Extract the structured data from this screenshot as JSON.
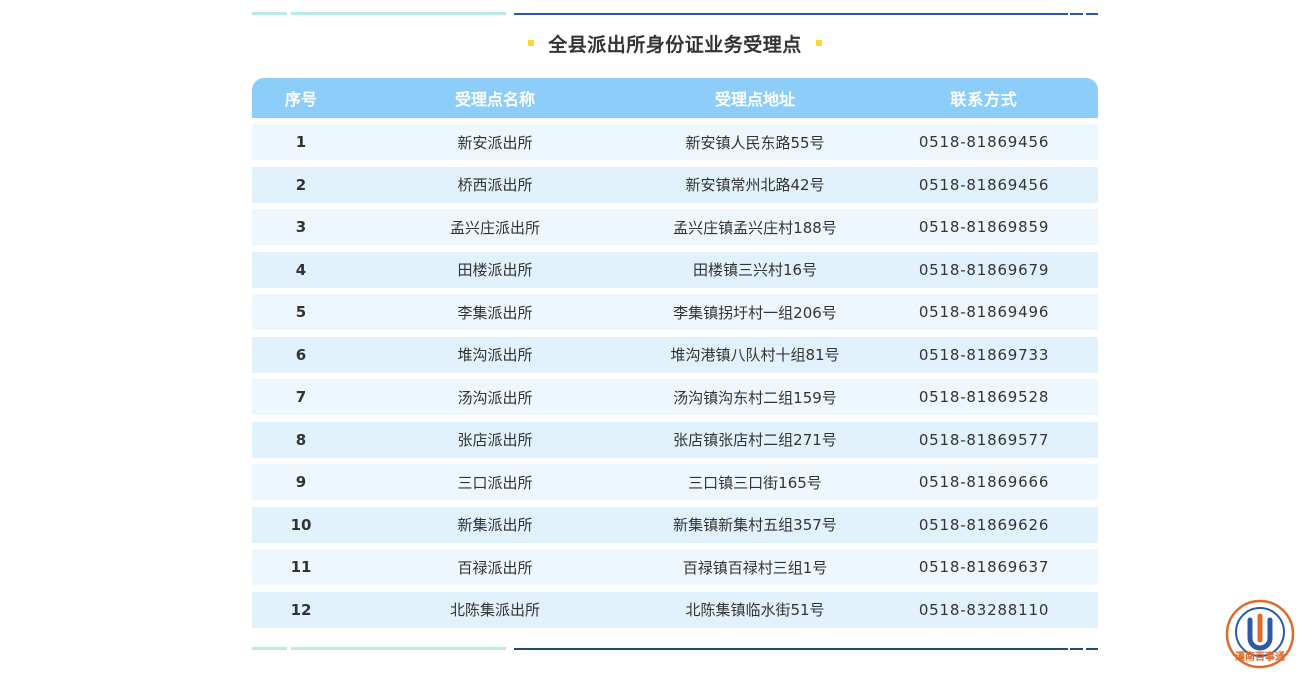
{
  "title": "全县派出所身份证业务受理点",
  "colors": {
    "header_bg": "#8ccdfa",
    "row_odd": "#eef7fe",
    "row_even": "#e2f2fd",
    "accent_dot": "#f5d83a",
    "line_dark": "#2c5aa6",
    "line_light": "#b9ece9"
  },
  "table": {
    "headers": [
      "序号",
      "受理点名称",
      "受理点地址",
      "联系方式"
    ],
    "rows": [
      {
        "no": "1",
        "name": "新安派出所",
        "address": "新安镇人民东路55号",
        "phone": "0518-81869456"
      },
      {
        "no": "2",
        "name": "桥西派出所",
        "address": "新安镇常州北路42号",
        "phone": "0518-81869456"
      },
      {
        "no": "3",
        "name": "孟兴庄派出所",
        "address": "孟兴庄镇孟兴庄村188号",
        "phone": "0518-81869859"
      },
      {
        "no": "4",
        "name": "田楼派出所",
        "address": "田楼镇三兴村16号",
        "phone": "0518-81869679"
      },
      {
        "no": "5",
        "name": "李集派出所",
        "address": "李集镇拐圩村一组206号",
        "phone": "0518-81869496"
      },
      {
        "no": "6",
        "name": "堆沟派出所",
        "address": "堆沟港镇八队村十组81号",
        "phone": "0518-81869733"
      },
      {
        "no": "7",
        "name": "汤沟派出所",
        "address": "汤沟镇沟东村二组159号",
        "phone": "0518-81869528"
      },
      {
        "no": "8",
        "name": "张店派出所",
        "address": "张店镇张店村二组271号",
        "phone": "0518-81869577"
      },
      {
        "no": "9",
        "name": "三口派出所",
        "address": "三口镇三口街165号",
        "phone": "0518-81869666"
      },
      {
        "no": "10",
        "name": "新集派出所",
        "address": "新集镇新集村五组357号",
        "phone": "0518-81869626"
      },
      {
        "no": "11",
        "name": "百禄派出所",
        "address": "百禄镇百禄村三组1号",
        "phone": "0518-81869637"
      },
      {
        "no": "12",
        "name": "北陈集派出所",
        "address": "北陈集镇临水街51号",
        "phone": "0518-83288110"
      }
    ]
  },
  "logo": {
    "icon": "news-app-logo-icon",
    "text": "灌南百事通"
  }
}
